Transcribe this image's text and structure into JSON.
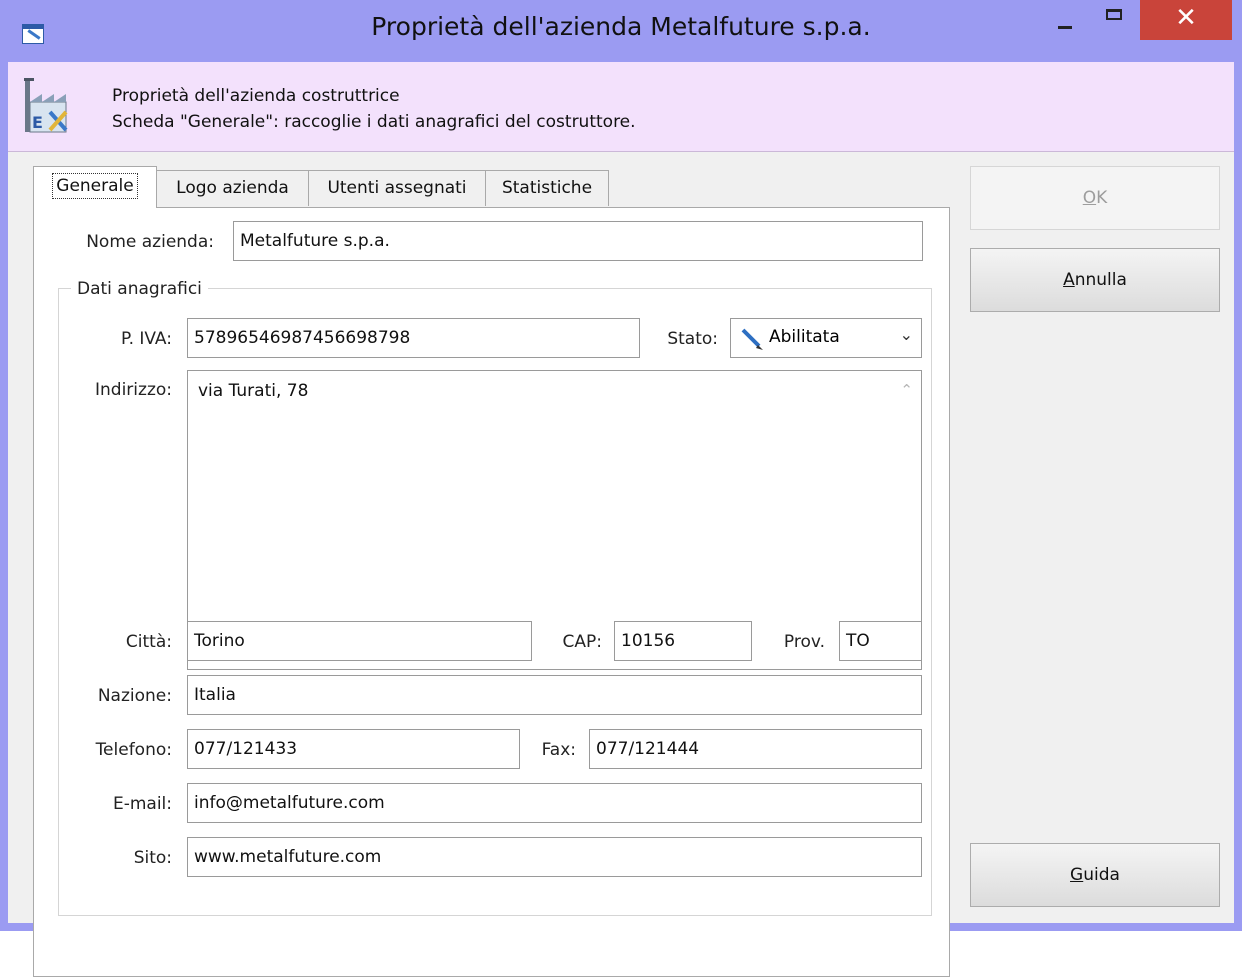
{
  "window": {
    "title": "Proprietà dell'azienda Metalfuture s.p.a.",
    "colors": {
      "frame": "#9b9bf2",
      "close": "#c9443a",
      "header_bg": "#f3e1fc"
    }
  },
  "header": {
    "line1": "Proprietà dell'azienda costruttrice",
    "line2": "Scheda \"Generale\": raccoglie i dati anagrafici del costruttore."
  },
  "tabs": [
    {
      "label": "Generale",
      "active": true
    },
    {
      "label": "Logo azienda",
      "active": false
    },
    {
      "label": "Utenti assegnati",
      "active": false
    },
    {
      "label": "Statistiche",
      "active": false
    }
  ],
  "form": {
    "nome_label": "Nome azienda:",
    "nome_value": "Metalfuture s.p.a.",
    "group_label": "Dati anagrafici",
    "piva_label": "P. IVA:",
    "piva_value": "57896546987456698798",
    "stato_label": "Stato:",
    "stato_value": "Abilitata",
    "indirizzo_label": "Indirizzo:",
    "indirizzo_value": "via Turati, 78",
    "citta_label": "Città:",
    "citta_value": "Torino",
    "cap_label": "CAP:",
    "cap_value": "10156",
    "prov_label": "Prov.",
    "prov_value": "TO",
    "nazione_label": "Nazione:",
    "nazione_value": "Italia",
    "telefono_label": "Telefono:",
    "telefono_value": "077/121433",
    "fax_label": "Fax:",
    "fax_value": "077/121444",
    "email_label": "E-mail:",
    "email_value": "info@metalfuture.com",
    "sito_label": "Sito:",
    "sito_value": "www.metalfuture.com"
  },
  "buttons": {
    "ok_first": "O",
    "ok_rest": "K",
    "annulla_first": "A",
    "annulla_rest": "nnulla",
    "guida_first": "G",
    "guida_rest": "uida"
  },
  "icons": [
    "app-icon",
    "minimize-icon",
    "maximize-icon",
    "close-icon",
    "factory-icon",
    "pencil-icon",
    "chevron-down-icon",
    "scroll-up-icon",
    "scroll-down-icon"
  ]
}
